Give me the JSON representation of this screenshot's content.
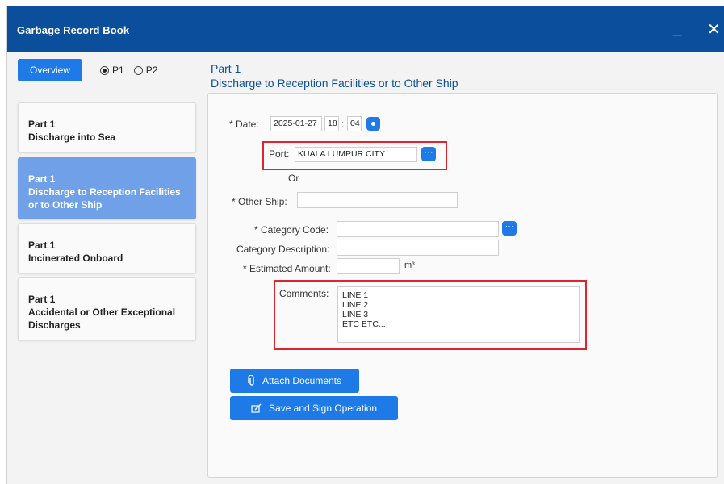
{
  "window": {
    "title": "Garbage Record Book",
    "minimize_label": "_",
    "close_label": "✕"
  },
  "toolbar": {
    "overview_label": "Overview",
    "radio_p1_label": "P1",
    "radio_p2_label": "P2",
    "selected": "P1"
  },
  "sidebar": {
    "items": [
      {
        "line1": "Part 1",
        "line2": "Discharge into Sea"
      },
      {
        "line1": "Part 1",
        "line2": "Discharge to Reception Facilities or to Other Ship"
      },
      {
        "line1": "Part 1",
        "line2": "Incinerated Onboard"
      },
      {
        "line1": "Part 1",
        "line2": "Accidental or Other Exceptional Discharges"
      }
    ]
  },
  "header": {
    "part": "Part 1",
    "subtitle": "Discharge to Reception Facilities or to Other Ship"
  },
  "form": {
    "date_label": "* Date:",
    "date_value": "2025-01-27",
    "hour_value": "18",
    "time_sep": ":",
    "minute_value": "04",
    "port_label": "Port:",
    "port_value": "KUALA LUMPUR CITY",
    "or_label": "Or",
    "other_ship_label": "* Other Ship:",
    "other_ship_value": "",
    "category_code_label": "* Category Code:",
    "category_code_value": "",
    "category_desc_label": "Category Description:",
    "category_desc_value": "",
    "estimated_amount_label": "* Estimated Amount:",
    "estimated_amount_value": "",
    "unit": "m³",
    "comments_label": "Comments:",
    "comments_lines": [
      "LINE 1",
      "LINE 2",
      "LINE 3",
      "ETC ETC..."
    ]
  },
  "actions": {
    "attach_label": "Attach Documents",
    "save_sign_label": "Save and Sign Operation"
  },
  "icons": {
    "attach": "paperclip-icon",
    "save_sign": "sign-icon",
    "ellipsis": "ellipsis-icon",
    "time_picker": "time-picker-icon"
  },
  "colors": {
    "titlebar": "#0b4f9c",
    "accent": "#1e7ae6",
    "active_item": "#6fa0e8",
    "highlight": "#e0242d"
  }
}
